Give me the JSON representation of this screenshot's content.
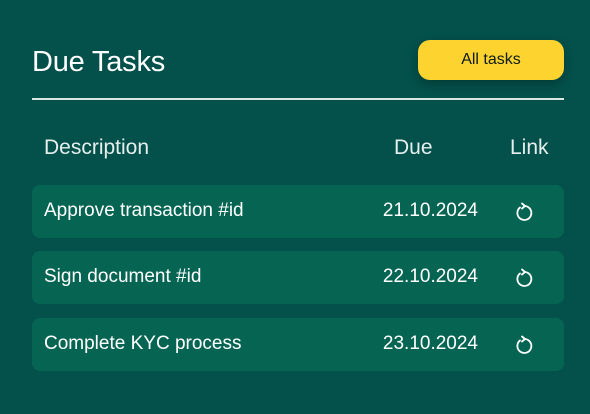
{
  "header": {
    "title": "Due Tasks",
    "all_tasks_label": "All tasks"
  },
  "columns": {
    "description": "Description",
    "due": "Due",
    "link": "Link"
  },
  "rows": [
    {
      "description": "Approve transaction #id",
      "due": "21.10.2024",
      "link_icon": "refresh-icon"
    },
    {
      "description": "Sign document #id",
      "due": "22.10.2024",
      "link_icon": "refresh-icon"
    },
    {
      "description": "Complete KYC process",
      "due": "23.10.2024",
      "link_icon": "refresh-icon"
    }
  ],
  "colors": {
    "background": "#04504a",
    "row_background": "#066552",
    "accent_button": "#fdd330",
    "text": "#ffffff"
  }
}
